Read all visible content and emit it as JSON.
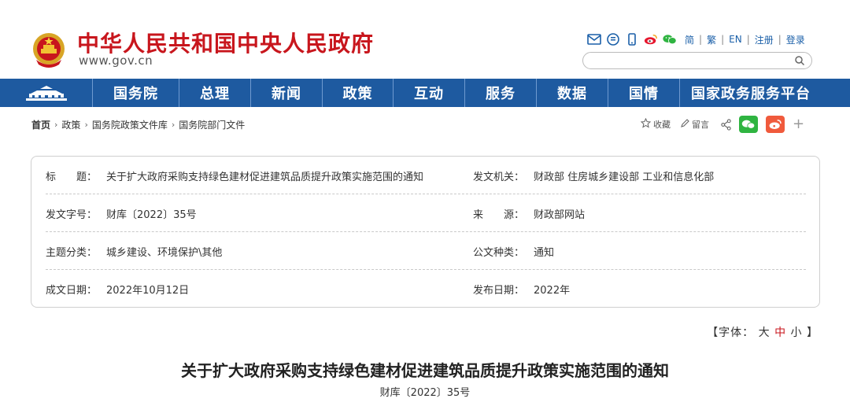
{
  "header": {
    "site_title": "中华人民共和国中央人民政府",
    "site_url": "www.gov.cn",
    "lang_links": [
      "简",
      "繁",
      "EN",
      "注册",
      "登录"
    ],
    "search_placeholder": ""
  },
  "nav": {
    "items": [
      "国务院",
      "总理",
      "新闻",
      "政策",
      "互动",
      "服务",
      "数据",
      "国情",
      "国家政务服务平台"
    ]
  },
  "breadcrumb": {
    "home": "首页",
    "items": [
      "政策",
      "国务院政策文件库",
      "国务院部门文件"
    ]
  },
  "share": {
    "favorite": "收藏",
    "comment": "留言"
  },
  "info": {
    "title_label": "标　　题：",
    "title_value": "关于扩大政府采购支持绿色建材促进建筑品质提升政策实施范围的通知",
    "issuer_label": "发文机关：",
    "issuer_value": "财政部  住房城乡建设部  工业和信息化部",
    "docno_label": "发文字号：",
    "docno_value": "财库〔2022〕35号",
    "source_label": "来　　源：",
    "source_value": "财政部网站",
    "topic_label": "主题分类：",
    "topic_value": "城乡建设、环境保护\\其他",
    "type_label": "公文种类：",
    "type_value": "通知",
    "date_label": "成文日期：",
    "date_value": "2022年10月12日",
    "pub_label": "发布日期：",
    "pub_value": "2022年"
  },
  "font_control": {
    "prefix": "【字体：",
    "big": "大",
    "mid": "中",
    "small": "小",
    "suffix": "】"
  },
  "document": {
    "title": "关于扩大政府采购支持绿色建材促进建筑品质提升政策实施范围的通知",
    "number": "财库〔2022〕35号"
  },
  "colors": {
    "brand_red": "#c8161d",
    "nav_blue": "#1e5aa0",
    "wechat_green": "#2fb441",
    "weibo_orange": "#f05a3c"
  }
}
